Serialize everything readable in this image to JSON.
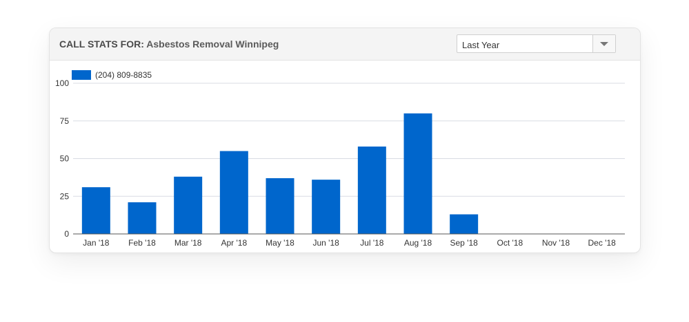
{
  "header": {
    "label": "CALL STATS FOR:",
    "name": "Asbestos Removal Winnipeg"
  },
  "period_select": {
    "value": "Last Year",
    "icon": "chevron-down-icon"
  },
  "colors": {
    "bar": "#0066cc",
    "grid": "#d8dbe3",
    "axis": "#555555"
  },
  "chart_data": {
    "type": "bar",
    "categories": [
      "Jan '18",
      "Feb '18",
      "Mar '18",
      "Apr '18",
      "May '18",
      "Jun '18",
      "Jul '18",
      "Aug '18",
      "Sep '18",
      "Oct '18",
      "Nov '18",
      "Dec '18"
    ],
    "series": [
      {
        "name": "(204) 809-8835",
        "values": [
          31,
          21,
          38,
          55,
          37,
          36,
          58,
          80,
          13,
          0,
          0,
          0
        ]
      }
    ],
    "ylim": [
      0,
      100
    ],
    "yticks": [
      0,
      25,
      50,
      75,
      100
    ],
    "grid": true,
    "legend": "top-left"
  }
}
